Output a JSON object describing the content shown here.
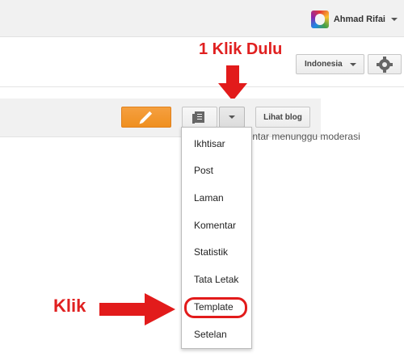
{
  "header": {
    "user_name": "Ahmad Rifai"
  },
  "toolbar": {
    "language_label": "Indonesia",
    "view_blog_label": "Lihat blog"
  },
  "blog": {
    "moderation_text": "komentar menunggu moderasi"
  },
  "menu": {
    "items": [
      "Ikhtisar",
      "Post",
      "Laman",
      "Komentar",
      "Statistik",
      "Tata Letak",
      "Template",
      "Setelan"
    ]
  },
  "annotations": {
    "top_text": "1 Klik Dulu",
    "left_text": "Klik",
    "color": "#e21b1b"
  },
  "icons": {
    "avatar": "avatar-icon",
    "settings": "gear-icon",
    "edit": "pencil-icon",
    "pages": "documents-icon",
    "dropdown": "chevron-down-icon"
  },
  "colors": {
    "accent_orange": "#ef8f1f",
    "annotation_red": "#e21b1b"
  }
}
